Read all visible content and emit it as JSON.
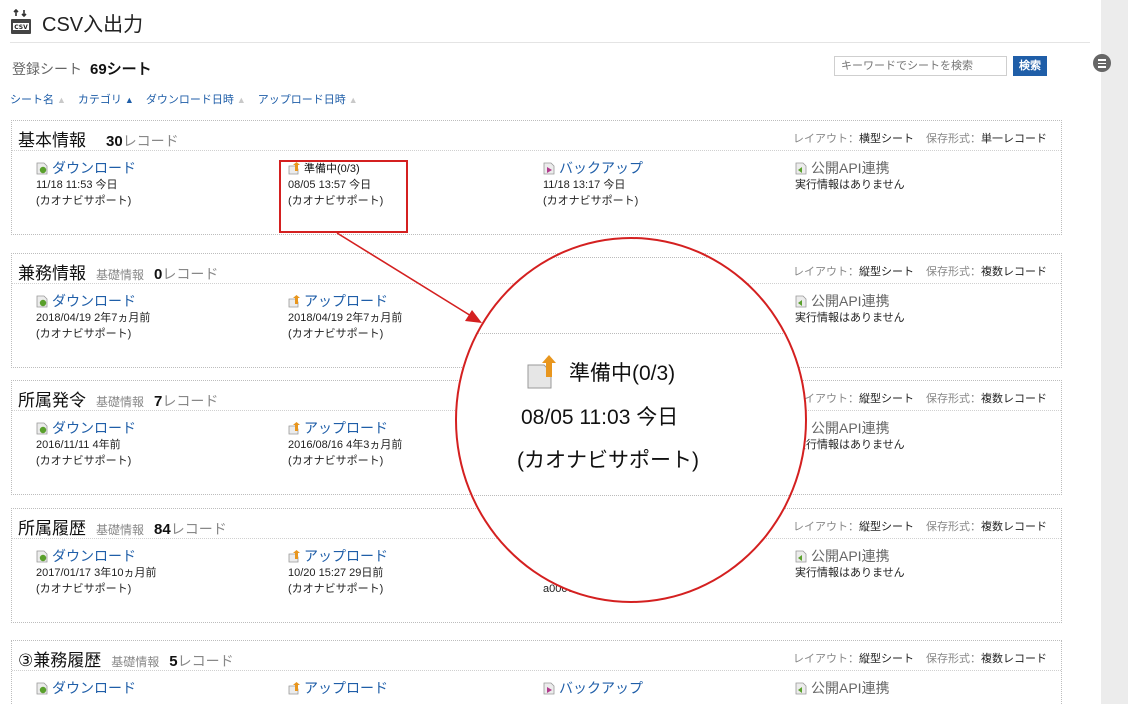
{
  "header": {
    "title": "CSV入出力",
    "icon": "csv-icon"
  },
  "summary": {
    "label": "登録シート",
    "count": "69シート"
  },
  "search": {
    "placeholder": "キーワードでシートを検索",
    "button": "検索"
  },
  "sort": [
    {
      "label": "シート名",
      "active": false
    },
    {
      "label": "カテゴリ",
      "active": true
    },
    {
      "label": "ダウンロード日時",
      "active": false
    },
    {
      "label": "アップロード日時",
      "active": false
    }
  ],
  "sheets": [
    {
      "name": "基本情報",
      "category": "",
      "count": "30",
      "unit": "レコード",
      "layout_label": "レイアウト：",
      "layout": "横型シート",
      "format_label": "保存形式：",
      "format": "単一レコード",
      "cols": [
        {
          "label": "ダウンロード",
          "l1": "11/18 11:53 今日",
          "l2": "(カオナビサポート)"
        },
        {
          "label": "準備中(0/3)",
          "l1": "08/05 13:57 今日",
          "l2": "(カオナビサポート)"
        },
        {
          "label": "バックアップ",
          "l1": "11/18 13:17 今日",
          "l2": "(カオナビサポート)"
        },
        {
          "label": "公開API連携",
          "l1": "実行情報はありません",
          "l2": ""
        }
      ]
    },
    {
      "name": "兼務情報",
      "category": "基礎情報",
      "count": "0",
      "unit": "レコード",
      "layout_label": "レイアウト：",
      "layout": "縦型シート",
      "format_label": "保存形式：",
      "format": "複数レコード",
      "cols": [
        {
          "label": "ダウンロード",
          "l1": "2018/04/19 2年7ヵ月前",
          "l2": "(カオナビサポート)"
        },
        {
          "label": "アップロード",
          "l1": "2018/04/19 2年7ヵ月前",
          "l2": "(カオナビサポート)"
        },
        {
          "label": "",
          "l1": "",
          "l2": ""
        },
        {
          "label": "公開API連携",
          "l1": "実行情報はありません",
          "l2": ""
        }
      ]
    },
    {
      "name": "所属発令",
      "category": "基礎情報",
      "count": "7",
      "unit": "レコード",
      "layout_label": "レイアウト：",
      "layout": "縦型シート",
      "format_label": "保存形式：",
      "format": "複数レコード",
      "cols": [
        {
          "label": "ダウンロード",
          "l1": "2016/11/11 4年前",
          "l2": "(カオナビサポート)"
        },
        {
          "label": "アップロード",
          "l1": "2016/08/16 4年3ヵ月前",
          "l2": "(カオナビサポート)"
        },
        {
          "label": "",
          "l1": "",
          "l2": ""
        },
        {
          "label": "公開API連携",
          "l1": "実行情報はありません",
          "l2": ""
        }
      ]
    },
    {
      "name": "所属履歴",
      "category": "基礎情報",
      "count": "84",
      "unit": "レコード",
      "layout_label": "レイアウト：",
      "layout": "縦型シート",
      "format_label": "保存形式：",
      "format": "複数レコード",
      "cols": [
        {
          "label": "ダウンロード",
          "l1": "2017/01/17 3年10ヵ月前",
          "l2": "(カオナビサポート)"
        },
        {
          "label": "アップロード",
          "l1": "10/20 15:27 29日前",
          "l2": "(カオナビサポート)"
        },
        {
          "label": "",
          "l1": "10/20 12:... 29日前",
          "l2": "a0007 | 伊藤 太輔"
        },
        {
          "label": "公開API連携",
          "l1": "実行情報はありません",
          "l2": ""
        }
      ]
    },
    {
      "name": "③兼務履歴",
      "category": "基礎情報",
      "count": "5",
      "unit": "レコード",
      "layout_label": "レイアウト：",
      "layout": "縦型シート",
      "format_label": "保存形式：",
      "format": "複数レコード",
      "cols": [
        {
          "label": "ダウンロード",
          "l1": "",
          "l2": ""
        },
        {
          "label": "アップロード",
          "l1": "",
          "l2": ""
        },
        {
          "label": "バックアップ",
          "l1": "",
          "l2": ""
        },
        {
          "label": "公開API連携",
          "l1": "",
          "l2": ""
        }
      ]
    }
  ],
  "zoom": {
    "title": "準備中(0/3)",
    "line1": "08/05 11:03 今日",
    "line2": "(カオナビサポート)"
  },
  "colors": {
    "link": "#1f5ea8",
    "highlight": "#d42020"
  }
}
